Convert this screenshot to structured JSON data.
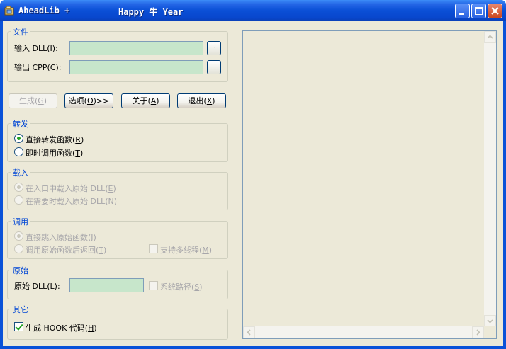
{
  "window": {
    "title_left": "AheadLib +",
    "title_mid": "Happy 牛 Year"
  },
  "input_group": {
    "title": "文件",
    "input_dll_label": "输入 DLL",
    "input_dll_mnemonic": "I",
    "input_dll_value": "",
    "output_cpp_label": "输出 CPP",
    "output_cpp_mnemonic": "C",
    "output_cpp_value": "",
    "browse_label": ".."
  },
  "actions": {
    "generate_label": "生成",
    "generate_mnemonic": "G",
    "options_label": "选项",
    "options_mnemonic": "O",
    "options_suffix": ">>",
    "about_label": "关于",
    "about_mnemonic": "A",
    "exit_label": "退出",
    "exit_mnemonic": "X"
  },
  "forward_group": {
    "title": "转发",
    "direct_label": "直接转发函数",
    "direct_mnemonic": "R",
    "direct_checked": true,
    "call_label": "即时调用函数",
    "call_mnemonic": "T",
    "call_checked": false
  },
  "load_group": {
    "title": "载入",
    "entry_label": "在入口中载入原始 DLL",
    "entry_mnemonic": "E",
    "entry_checked": true,
    "ondemand_label": "在需要时载入原始 DLL",
    "ondemand_mnemonic": "N",
    "ondemand_checked": false
  },
  "call_group": {
    "title": "调用",
    "jump_label": "直接跳入原始函数",
    "jump_mnemonic": "J",
    "jump_checked": true,
    "return_label": "调用原始函数后返回",
    "return_mnemonic": "T",
    "return_checked": false,
    "multithread_label": "支持多线程",
    "multithread_mnemonic": "M",
    "multithread_checked": false
  },
  "original_group": {
    "title": "原始",
    "original_dll_label": "原始 DLL",
    "original_dll_mnemonic": "L",
    "original_dll_value": "",
    "system_path_label": "系统路径",
    "system_path_mnemonic": "S",
    "system_path_checked": false
  },
  "other_group": {
    "title": "其它",
    "hook_label": "生成 HOOK 代码",
    "hook_mnemonic": "H",
    "hook_checked": true
  },
  "output": {
    "text": ""
  },
  "icons": {
    "app": "app-icon",
    "minimize": "minimize-icon",
    "maximize": "maximize-icon",
    "close": "close-icon"
  }
}
